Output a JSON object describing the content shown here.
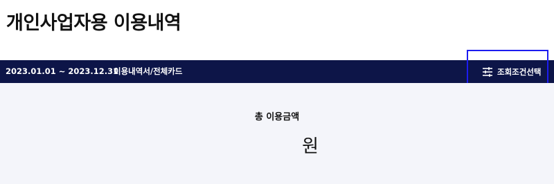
{
  "page": {
    "title": "개인사업자용 이용내역"
  },
  "filter_bar": {
    "period": "2023.01.01 ~ 2023.12.31",
    "scope": "이용내역서/전체카드",
    "filter_button_label": "조회조건선택",
    "filter_icon": "sliders-icon"
  },
  "summary": {
    "total_label": "총 이용금액",
    "total_value": "",
    "total_unit": "원"
  },
  "colors": {
    "filter_bar_bg": "#0d1548",
    "summary_bg": "#f4f5fa",
    "highlight_border": "#1c1cf0"
  }
}
